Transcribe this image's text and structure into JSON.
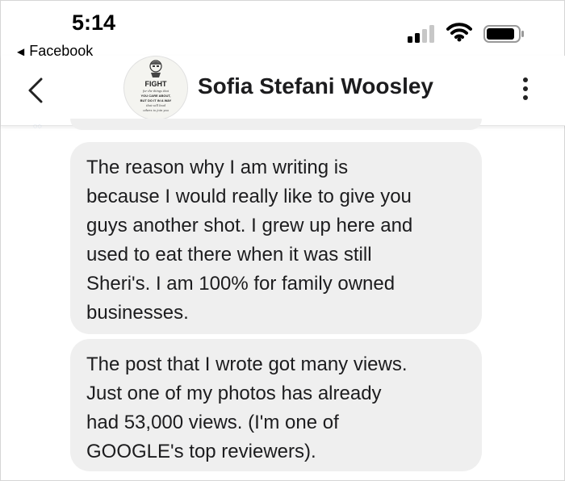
{
  "status_bar": {
    "time": "5:14",
    "back_app_label": "Facebook",
    "icons": [
      "cellular-signal-icon",
      "wifi-icon",
      "battery-icon"
    ]
  },
  "header": {
    "contact_name": "Sofia Stefani Woosley",
    "avatar_text": {
      "title": "FIGHT",
      "lines": [
        "for the things that",
        "YOU CARE ABOUT,",
        "BUT DO IT IN A WAY",
        "that will lead",
        "others to join you"
      ]
    }
  },
  "messages": [
    {
      "lines": [
        "The reason why I am writing is",
        "because I would really like to give you",
        "guys another shot. I grew up here and",
        "used to eat there when it was still",
        "Sheri's. I am 100% for family owned",
        "businesses."
      ]
    },
    {
      "lines": [
        "The post that I wrote got many views.",
        "Just one of my photos has already",
        "had 53,000 views. (I'm one of",
        "GOOGLE's top reviewers)."
      ]
    }
  ],
  "colors": {
    "bubble": "#efefef",
    "text": "#1c1c1e",
    "background": "#ffffff"
  }
}
